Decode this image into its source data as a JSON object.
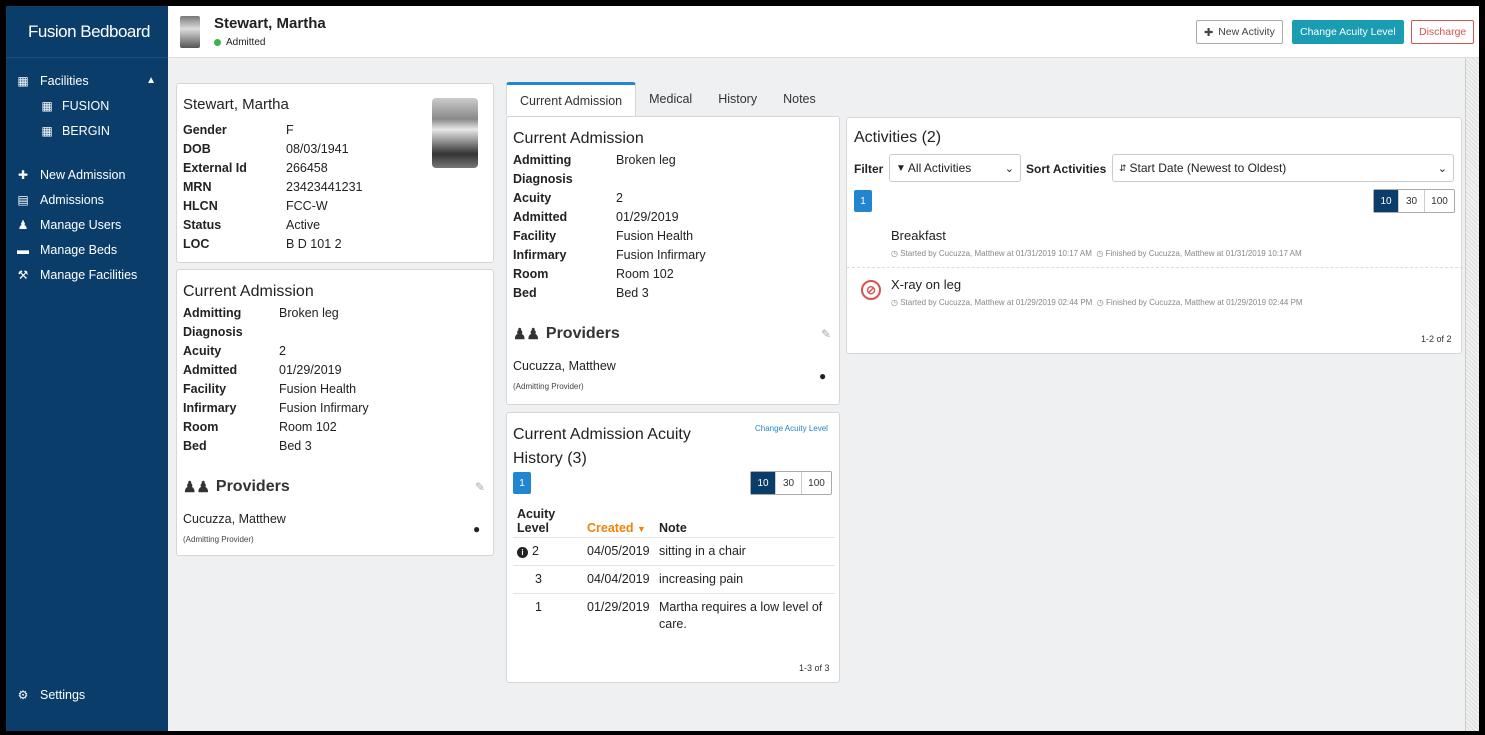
{
  "app": {
    "brand": "Fusion Bedboard"
  },
  "sidebar": {
    "facilities_label": "Facilities",
    "facilities": [
      {
        "label": "FUSION"
      },
      {
        "label": "BERGIN"
      }
    ],
    "items": [
      {
        "label": "New Admission",
        "icon": "plus-icon"
      },
      {
        "label": "Admissions",
        "icon": "id-card-icon"
      },
      {
        "label": "Manage Users",
        "icon": "user-icon"
      },
      {
        "label": "Manage Beds",
        "icon": "bed-icon"
      },
      {
        "label": "Manage Facilities",
        "icon": "wrench-icon"
      }
    ],
    "settings_label": "Settings"
  },
  "header": {
    "patient_name": "Stewart, Martha",
    "status": "Admitted",
    "status_color": "#3bb54a",
    "new_activity_label": "New Activity",
    "change_acuity_label": "Change Acuity Level",
    "discharge_label": "Discharge"
  },
  "patient_card": {
    "name": "Stewart, Martha",
    "fields": [
      {
        "k": "Gender",
        "v": "F"
      },
      {
        "k": "DOB",
        "v": "08/03/1941"
      },
      {
        "k": "External Id",
        "v": "266458"
      },
      {
        "k": "MRN",
        "v": "23423441231"
      },
      {
        "k": "HLCN",
        "v": "FCC-W"
      },
      {
        "k": "Status",
        "v": "Active"
      },
      {
        "k": "LOC",
        "v": "B D 101 2"
      }
    ]
  },
  "admission": {
    "title": "Current Admission",
    "fields": [
      {
        "k": "Admitting",
        "v": "Broken leg"
      },
      {
        "k": "Diagnosis",
        "v": ""
      },
      {
        "k": "Acuity",
        "v": "2"
      },
      {
        "k": "Admitted",
        "v": "01/29/2019"
      },
      {
        "k": "Facility",
        "v": "Fusion Health"
      },
      {
        "k": "Infirmary",
        "v": "Fusion Infirmary"
      },
      {
        "k": "Room",
        "v": "Room 102"
      },
      {
        "k": "Bed",
        "v": "Bed 3"
      }
    ],
    "providers_title": "Providers",
    "provider_name": "Cucuzza, Matthew",
    "provider_role": "(Admitting Provider)"
  },
  "tabs": [
    {
      "label": "Current Admission",
      "active": true
    },
    {
      "label": "Medical"
    },
    {
      "label": "History"
    },
    {
      "label": "Notes"
    }
  ],
  "acuity_history": {
    "title_line1": "Current Admission Acuity",
    "title_line2": "History (3)",
    "change_link": "Change Acuity Level",
    "page": "1",
    "page_sizes": [
      "10",
      "30",
      "100"
    ],
    "col_level_1": "Acuity",
    "col_level_2": "Level",
    "col_created": "Created",
    "col_note": "Note",
    "rows": [
      {
        "level": "2",
        "created": "04/05/2019",
        "note": "sitting in a chair",
        "info": true
      },
      {
        "level": "3",
        "created": "04/04/2019",
        "note": "increasing pain"
      },
      {
        "level": "1",
        "created": "01/29/2019",
        "note": "Martha requires a low level of care."
      }
    ],
    "count": "1-3 of 3"
  },
  "activities": {
    "title": "Activities (2)",
    "filter_label": "Filter",
    "filter_value": "All Activities",
    "sort_label": "Sort Activities",
    "sort_value": "Start Date (Newest to Oldest)",
    "page": "1",
    "page_sizes": [
      "10",
      "30",
      "100"
    ],
    "items": [
      {
        "name": "Breakfast",
        "started": "Started by Cucuzza, Matthew at 01/31/2019 10:17 AM",
        "finished": "Finished by Cucuzza, Matthew at 01/31/2019 10:17 AM"
      },
      {
        "name": "X-ray on leg",
        "started": "Started by Cucuzza, Matthew at 01/29/2019 02:44 PM",
        "finished": "Finished by Cucuzza, Matthew at 01/29/2019 02:44 PM"
      }
    ],
    "count": "1-2 of 2"
  }
}
